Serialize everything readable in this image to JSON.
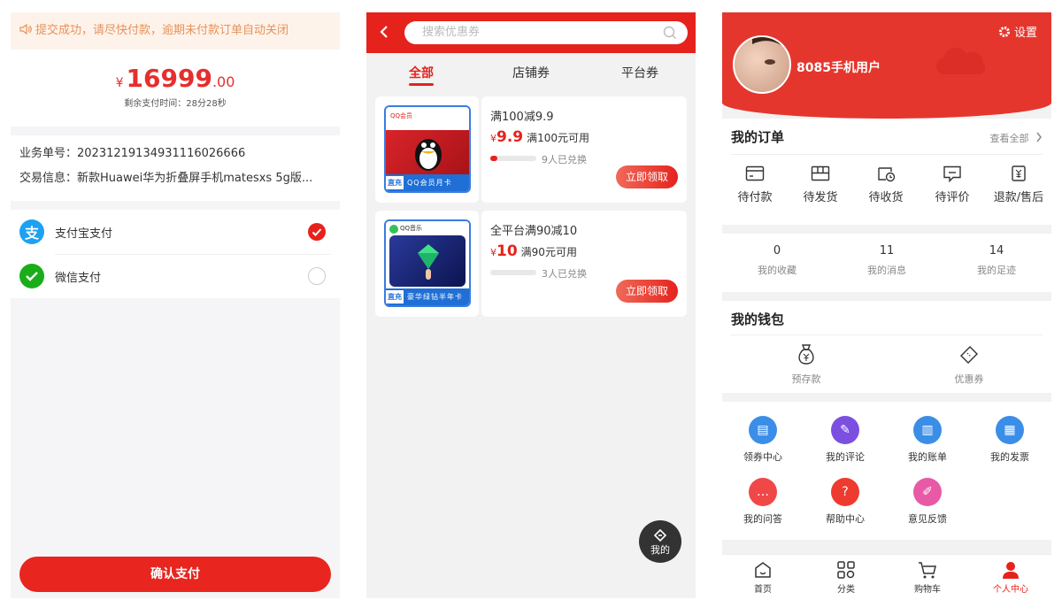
{
  "payment": {
    "notice": "提交成功，请尽快付款，逾期未付款订单自动关闭",
    "currency": "¥",
    "amount_int": "16999",
    "amount_dec": ".00",
    "remaining": "剩余支付时间：28分28秒",
    "order_label": "业务单号：",
    "order_no": "20231219134931116026666",
    "trade_label": "交易信息：",
    "trade_info": "新款Huawei华为折叠屏手机matesxs 5g版...",
    "methods": [
      {
        "label": "支付宝支付",
        "selected": true,
        "color": "#1da1f2"
      },
      {
        "label": "微信支付",
        "selected": false,
        "color": "#1aad19"
      }
    ],
    "confirm": "确认支付"
  },
  "coupons": {
    "search_placeholder": "搜索优惠券",
    "tabs": [
      "全部",
      "店铺券",
      "平台券"
    ],
    "active_tab": 0,
    "items": [
      {
        "title": "满100减9.9",
        "currency": "¥",
        "price": "9.9",
        "condition": "满100元可用",
        "progress": 0.15,
        "claimed": "9人已兑换",
        "button": "立即领取",
        "badge": "直充",
        "caption": "QQ会员月卡",
        "brand": "QQ会员"
      },
      {
        "title": "全平台满90减10",
        "currency": "¥",
        "price": "10",
        "condition": "满90元可用",
        "progress": 0,
        "claimed": "3人已兑换",
        "button": "立即领取",
        "badge": "直充",
        "caption": "豪华绿钻半年卡",
        "brand": "QQ音乐"
      }
    ],
    "fab_label": "我的"
  },
  "profile": {
    "settings": "设置",
    "username": "8085手机用户",
    "orders_title": "我的订单",
    "orders_more": "查看全部",
    "order_items": [
      "待付款",
      "待发货",
      "待收货",
      "待评价",
      "退款/售后"
    ],
    "stats": [
      {
        "value": "0",
        "label": "我的收藏"
      },
      {
        "value": "11",
        "label": "我的消息"
      },
      {
        "value": "14",
        "label": "我的足迹"
      }
    ],
    "wallet_title": "我的钱包",
    "wallet_items": [
      "预存款",
      "优惠券"
    ],
    "services": [
      {
        "label": "领券中心",
        "color": "#3b8ee8"
      },
      {
        "label": "我的评论",
        "color": "#7b4fe0"
      },
      {
        "label": "我的账单",
        "color": "#3b8ee8"
      },
      {
        "label": "我的发票",
        "color": "#3b8ee8"
      },
      {
        "label": "我的问答",
        "color": "#f04848"
      },
      {
        "label": "帮助中心",
        "color": "#ee3b2f"
      },
      {
        "label": "意见反馈",
        "color": "#e85aa6"
      }
    ],
    "nav": [
      "首页",
      "分类",
      "购物车",
      "个人中心"
    ],
    "nav_active": 3,
    "accent": "#e5231c"
  }
}
